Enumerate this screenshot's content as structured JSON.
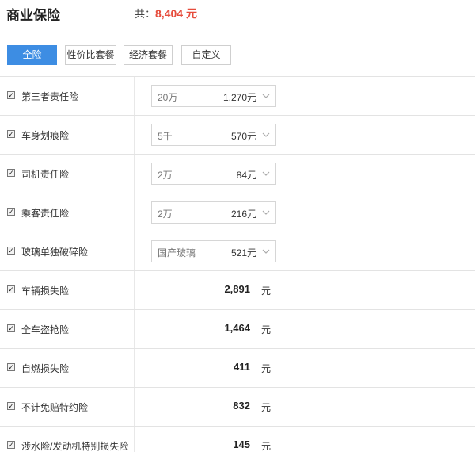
{
  "header": {
    "title": "商业保险",
    "total_label": "共：",
    "total_amount": "8,404 元"
  },
  "tabs": [
    {
      "label": "全险",
      "active": true
    },
    {
      "label": "性价比套餐",
      "active": false
    },
    {
      "label": "经济套餐",
      "active": false
    },
    {
      "label": "自定义",
      "active": false
    }
  ],
  "colors": {
    "accent": "#3d8de3",
    "total": "#e64c3c"
  },
  "items": [
    {
      "label": "第三者责任险",
      "checked": true,
      "option": "20万",
      "price": "1,270元"
    },
    {
      "label": "车身划痕险",
      "checked": true,
      "option": "5千",
      "price": "570元"
    },
    {
      "label": "司机责任险",
      "checked": true,
      "option": "2万",
      "price": "84元"
    },
    {
      "label": "乘客责任险",
      "checked": true,
      "option": "2万",
      "price": "216元"
    },
    {
      "label": "玻璃单独破碎险",
      "checked": true,
      "option": "国产玻璃",
      "price": "521元"
    },
    {
      "label": "车辆损失险",
      "checked": true,
      "value": "2,891",
      "unit": "元"
    },
    {
      "label": "全车盗抢险",
      "checked": true,
      "value": "1,464",
      "unit": "元"
    },
    {
      "label": "自燃损失险",
      "checked": true,
      "value": "411",
      "unit": "元"
    },
    {
      "label": "不计免赔特约险",
      "checked": true,
      "value": "832",
      "unit": "元"
    },
    {
      "label": "涉水险/发动机特别损失险",
      "checked": true,
      "value": "145",
      "unit": "元"
    }
  ],
  "icons": {
    "checkbox": "checkmark-icon",
    "dropdown": "chevron-down-icon"
  }
}
